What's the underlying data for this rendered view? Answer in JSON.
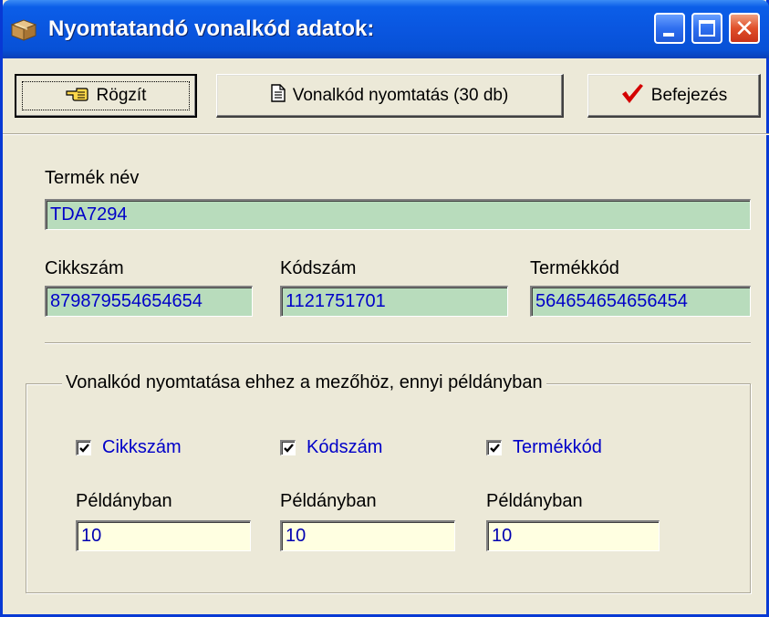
{
  "window": {
    "title": "Nyomtatandó vonalkód adatok:",
    "close_glyph": "✕"
  },
  "toolbar": {
    "rogzit_label": "Rögzít",
    "print_label": "Vonalkód nyomtatás (30 db)",
    "finish_label": "Befejezés"
  },
  "form": {
    "termek_nev_label": "Termék név",
    "termek_nev_value": "TDA7294",
    "cikkszam_label": "Cikkszám",
    "cikkszam_value": "879879554654654",
    "kodszam_label": "Kódszám",
    "kodszam_value": "1121751701",
    "termekkod_label": "Termékkód",
    "termekkod_value": "564654654656454"
  },
  "print_group": {
    "legend": "Vonalkód nyomtatása ehhez a mezőhöz, ennyi példányban",
    "checkboxes": [
      {
        "label": "Cikkszám",
        "checked": true
      },
      {
        "label": "Kódszám",
        "checked": true
      },
      {
        "label": "Termékkód",
        "checked": true
      }
    ],
    "copies": [
      {
        "label": "Példányban",
        "value": "10"
      },
      {
        "label": "Példányban",
        "value": "10"
      },
      {
        "label": "Példányban",
        "value": "10"
      }
    ]
  },
  "colors": {
    "titlebar": "#0a56e0",
    "window_bg": "#ece9d8",
    "field_green": "#b8dcbc",
    "field_yellow": "#ffffe1",
    "value_text": "#0000c8",
    "checkmark_red": "#d40000"
  },
  "icons": {
    "app": "package-box-icon",
    "rogzit": "pointing-hand-icon",
    "print": "document-icon",
    "finish": "red-checkmark-icon"
  }
}
